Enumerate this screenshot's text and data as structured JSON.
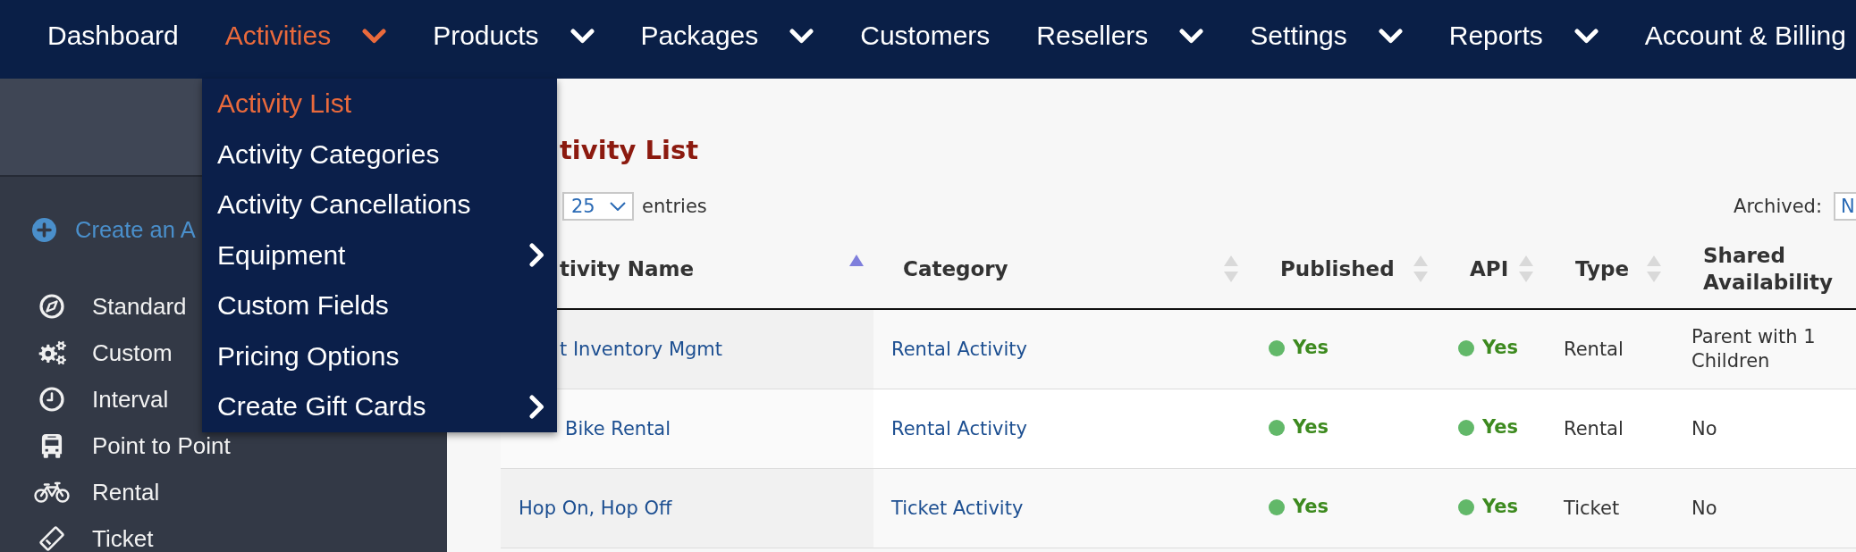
{
  "nav": {
    "items": [
      {
        "label": "Dashboard",
        "selected": false,
        "dropdown": false
      },
      {
        "label": "Activities",
        "selected": true,
        "dropdown": true
      },
      {
        "label": "Products",
        "selected": false,
        "dropdown": true
      },
      {
        "label": "Packages",
        "selected": false,
        "dropdown": true
      },
      {
        "label": "Customers",
        "selected": false,
        "dropdown": false
      },
      {
        "label": "Resellers",
        "selected": false,
        "dropdown": true
      },
      {
        "label": "Settings",
        "selected": false,
        "dropdown": true
      },
      {
        "label": "Reports",
        "selected": false,
        "dropdown": true
      },
      {
        "label": "Account & Billing",
        "selected": false,
        "dropdown": false
      }
    ]
  },
  "dropdown_menu": {
    "items": [
      {
        "label": "Activity List",
        "selected": true,
        "submenu": false
      },
      {
        "label": "Activity Categories",
        "selected": false,
        "submenu": false
      },
      {
        "label": "Activity Cancellations",
        "selected": false,
        "submenu": false
      },
      {
        "label": "Equipment",
        "selected": false,
        "submenu": true
      },
      {
        "label": "Custom Fields",
        "selected": false,
        "submenu": false
      },
      {
        "label": "Pricing Options",
        "selected": false,
        "submenu": false
      },
      {
        "label": "Create Gift Cards",
        "selected": false,
        "submenu": true
      }
    ]
  },
  "sidebar": {
    "create_link": "Create an A",
    "items": [
      {
        "label": "Standard"
      },
      {
        "label": "Custom"
      },
      {
        "label": "Interval"
      },
      {
        "label": "Point to Point"
      },
      {
        "label": "Rental"
      },
      {
        "label": "Ticket"
      }
    ]
  },
  "page": {
    "title": "tivity List",
    "page_length": "25",
    "length_suffix": "entries",
    "archived_label": "Archived:",
    "archived_value": "N"
  },
  "table": {
    "columns": [
      {
        "label": "tivity Name",
        "sorted": true
      },
      {
        "label": "Category",
        "sorted": false
      },
      {
        "label": "Published",
        "sorted": false
      },
      {
        "label": "API",
        "sorted": false
      },
      {
        "label": "Type",
        "sorted": false
      },
      {
        "label": "Shared Availability"
      }
    ],
    "rows": [
      {
        "name": "t Inventory Mgmt",
        "category": "Rental Activity",
        "published": {
          "text": "Yes",
          "on": true
        },
        "api": {
          "text": "Yes",
          "on": true
        },
        "type": "Rental",
        "shared": "Parent with 1 Children"
      },
      {
        "name": "Bike Rental",
        "category": "Rental Activity",
        "published": {
          "text": "Yes",
          "on": true
        },
        "api": {
          "text": "Yes",
          "on": true
        },
        "type": "Rental",
        "shared": "No"
      },
      {
        "name": "Hop On, Hop Off",
        "category": "Ticket Activity",
        "published": {
          "text": "Yes",
          "on": true
        },
        "api": {
          "text": "Yes",
          "on": true
        },
        "type": "Ticket",
        "shared": "No"
      }
    ]
  }
}
